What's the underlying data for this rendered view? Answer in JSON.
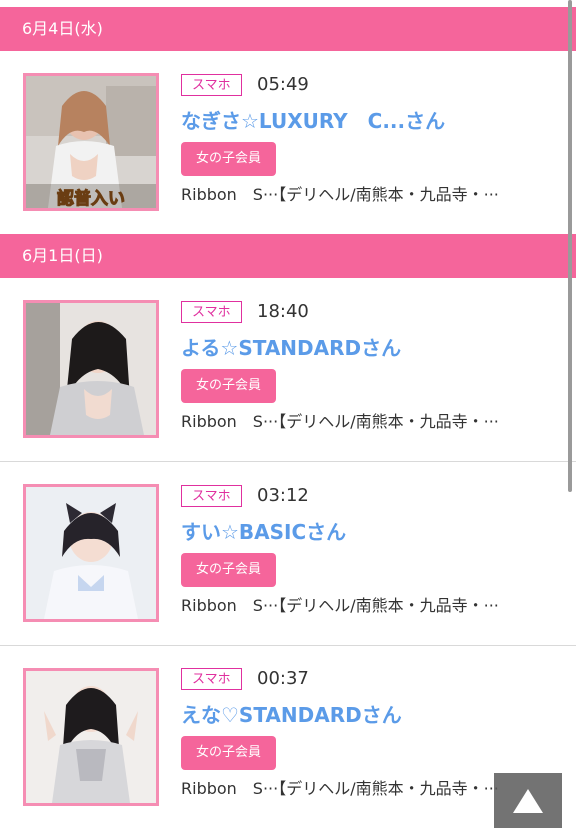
{
  "sections": [
    {
      "date": "6月4日(水)",
      "entries": [
        {
          "badge": "スマホ",
          "time": "05:49",
          "name": "なぎさ☆LUXURY　C...さん",
          "member": "女の子会員",
          "shop": "Ribbon　S···【デリヘル/南熊本・九品寺・···",
          "photo_caption": "認普入い"
        }
      ]
    },
    {
      "date": "6月1日(日)",
      "entries": [
        {
          "badge": "スマホ",
          "time": "18:40",
          "name": "よる☆STANDARDさん",
          "member": "女の子会員",
          "shop": "Ribbon　S···【デリヘル/南熊本・九品寺・···"
        },
        {
          "badge": "スマホ",
          "time": "03:12",
          "name": "すい☆BASICさん",
          "member": "女の子会員",
          "shop": "Ribbon　S···【デリヘル/南熊本・九品寺・···"
        },
        {
          "badge": "スマホ",
          "time": "00:37",
          "name": "えな♡STANDARDさん",
          "member": "女の子会員",
          "shop": "Ribbon　S···【デリヘル/南熊本・九品寺・···"
        }
      ]
    }
  ],
  "icons": {
    "back_to_top": "up-triangle-icon"
  },
  "colors": {
    "header_pink": "#f5659b",
    "name_blue": "#5b9be8",
    "badge_magenta": "#e0309f",
    "thumb_border": "#f58db3"
  }
}
